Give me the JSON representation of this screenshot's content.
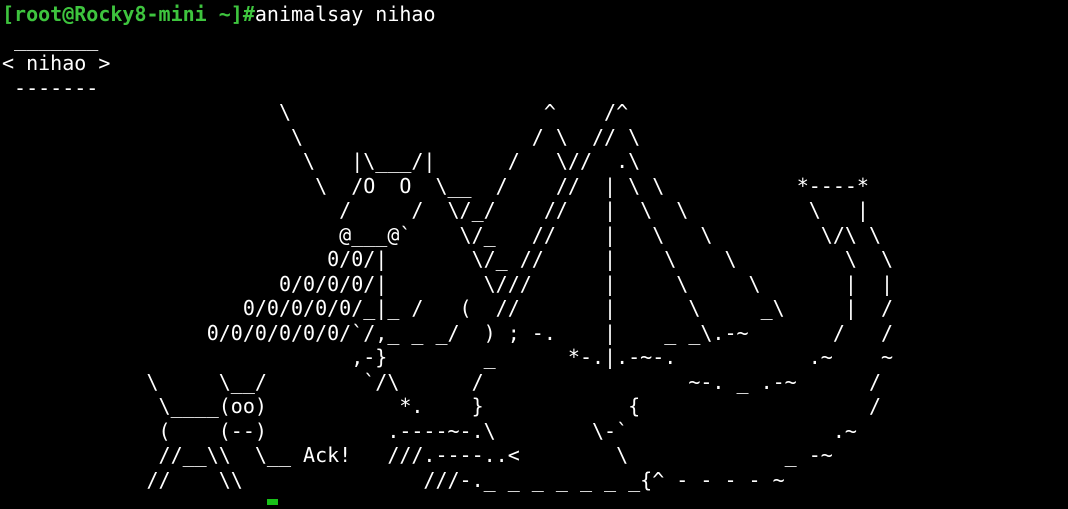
{
  "terminal": {
    "prompt": "[root@Rocky8-mini ~]#",
    "command": "animalsay nihao",
    "colors": {
      "background": "#000000",
      "text": "#ffffff",
      "prompt": "#3ec43e",
      "cursor": "#19c119"
    },
    "output_lines": [
      " _______",
      "< nihao >",
      " -------",
      "                       \\                     ^    /^",
      "                        \\                   / \\  // \\",
      "                         \\   |\\___/|      /   \\//  .\\",
      "                          \\  /O  O  \\__  /    //  | \\ \\           *----*",
      "                            /     /  \\/_/    //   |  \\  \\          \\   |",
      "                            @___@`    \\/_   //    |   \\   \\         \\/\\ \\",
      "                           0/0/|       \\/_ //     |    \\    \\         \\  \\",
      "                       0/0/0/0/|        \\///      |     \\     \\       |  |",
      "                    0/0/0/0/0/_|_ /   (  //       |      \\     _\\     |  /",
      "                 0/0/0/0/0/0/`/,_ _ _/  ) ; -.    |    _ _\\.-~       /   /",
      "                             ,-}        _      *-.|.-~-.           .~    ~",
      "            \\     \\__/        `/\\      /                 ~-. _ .-~      /",
      "             \\____(oo)           *.    }            {                   /",
      "             (    (--)          .----~-.\\        \\-`                 .~",
      "             //__\\\\  \\__ Ack!   ///.----..<        \\             _ -~"
    ],
    "last_line": "            //    \\\\               ///-._ _ _ _ _ _ _{^ - - - - ~"
  }
}
